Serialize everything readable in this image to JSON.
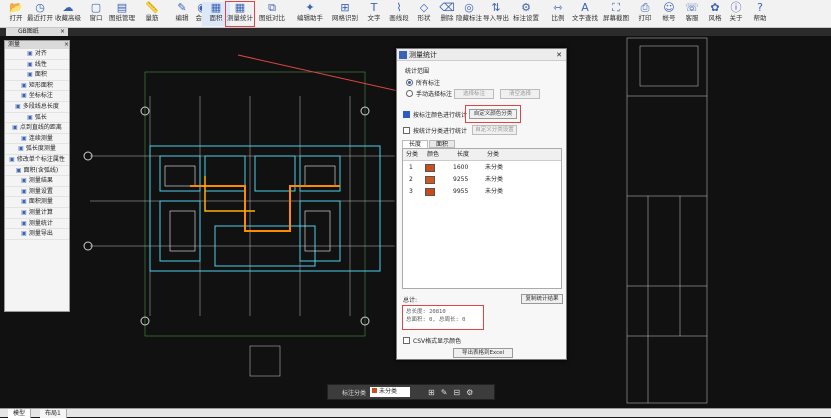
{
  "toolbar": [
    {
      "name": "open-button",
      "icon": "folder-open-icon",
      "label": "打开"
    },
    {
      "name": "recent-open-button",
      "icon": "clock-icon",
      "label": "最近打开"
    },
    {
      "name": "save-button",
      "icon": "cloud-save-icon",
      "label": "收藏高级"
    },
    {
      "name": "window-button",
      "icon": "window-icon",
      "label": "窗口"
    },
    {
      "name": "drawing-manage-button",
      "icon": "folder-icon",
      "label": "图纸管理"
    },
    {
      "name": "measure-button",
      "icon": "ruler-icon",
      "label": "量筋"
    },
    {
      "name": "edit-button",
      "icon": "edit-icon",
      "label": "编辑"
    },
    {
      "name": "vip-button",
      "icon": "vip-icon",
      "label": "会员"
    },
    {
      "name": "area-button",
      "icon": "area-icon",
      "label": "面积"
    },
    {
      "name": "measure-stats-button",
      "icon": "grid-table-icon",
      "label": "测量统计"
    },
    {
      "name": "drawing-compare-button",
      "icon": "compare-icon",
      "label": "图纸对比"
    },
    {
      "name": "drawing-assistant-button",
      "icon": "assistant-icon",
      "label": "编辑助手"
    },
    {
      "name": "grid-axis-button",
      "icon": "grid-axis-icon",
      "label": "网格识别"
    },
    {
      "name": "text-button",
      "icon": "text-icon",
      "label": "文字"
    },
    {
      "name": "polyline-button",
      "icon": "polyline-icon",
      "label": "画线段"
    },
    {
      "name": "shape-button",
      "icon": "shape-icon",
      "label": "形状"
    },
    {
      "name": "erase-button",
      "icon": "eraser-icon",
      "label": "删除"
    },
    {
      "name": "hide-mark-button",
      "icon": "eye-slash-icon",
      "label": "隐藏标注"
    },
    {
      "name": "import-button",
      "icon": "import-icon",
      "label": "导入导出"
    },
    {
      "name": "mark-settings-button",
      "icon": "settings-icon",
      "label": "标注设置"
    },
    {
      "name": "ratio-button",
      "icon": "ratio-icon",
      "label": "比例"
    },
    {
      "name": "text-search-button",
      "icon": "text-search-icon",
      "label": "文字查找"
    },
    {
      "name": "screen-capture-button",
      "icon": "capture-icon",
      "label": "屏幕截图"
    },
    {
      "name": "print-button",
      "icon": "printer-icon",
      "label": "打印"
    },
    {
      "name": "account-button",
      "icon": "user-icon",
      "label": "帐号"
    },
    {
      "name": "service-button",
      "icon": "headset-icon",
      "label": "客服"
    },
    {
      "name": "style-button",
      "icon": "palette-icon",
      "label": "风格"
    },
    {
      "name": "about-button",
      "icon": "info-icon",
      "label": "关于"
    },
    {
      "name": "help-button",
      "icon": "question-icon",
      "label": "帮助"
    }
  ],
  "file_tab": {
    "label": "GB图纸"
  },
  "left_panel": {
    "title": "测量",
    "items": [
      "对齐",
      "线性",
      "面积",
      "矩形面积",
      "坐标标注",
      "多段线总长度",
      "弧长",
      "点到直线的距离",
      "连续测量",
      "弧长度测量",
      "修改单个标注属性",
      "面积(含弧线)",
      "测量结果",
      "测量设置",
      "面积测量",
      "测量计算",
      "测量统计",
      "测量导出"
    ]
  },
  "dialog": {
    "title": "测量统计",
    "section_range": "统计范围",
    "radio_all": "所有标注",
    "radio_select": "手动选择标注",
    "btn_select": "选择标注",
    "btn_clear": "清空选择",
    "check_color": "按标注颜色进行统计",
    "btn_custom_color": "自定义颜色分类",
    "check_layer": "按统计分类进行统计",
    "btn_custom_layer": "自定义分类设置",
    "tab_length": "长度",
    "tab_area": "面积",
    "col_index": "分类",
    "col_color": "颜色",
    "col_length": "长度",
    "col_type": "分类",
    "rows": [
      {
        "index": "1",
        "color": "#c8501e",
        "length": "1600",
        "type": "未分类"
      },
      {
        "index": "2",
        "color": "#d2561e",
        "length": "9255",
        "type": "未分类"
      },
      {
        "index": "3",
        "color": "#c84a1a",
        "length": "9955",
        "type": "未分类"
      }
    ],
    "result_label": "总计:",
    "btn_copy": "复制统计结果",
    "result_line1": "总长度: 20810",
    "result_line2": "总面积: 0, 总周长: 0",
    "check_excel": "CSV格式显示颜色",
    "btn_export": "导出表格到Excel"
  },
  "bottom_bar": {
    "label": "标注分类",
    "value": "未分类"
  },
  "status_tabs": [
    "模型",
    "布局1"
  ]
}
